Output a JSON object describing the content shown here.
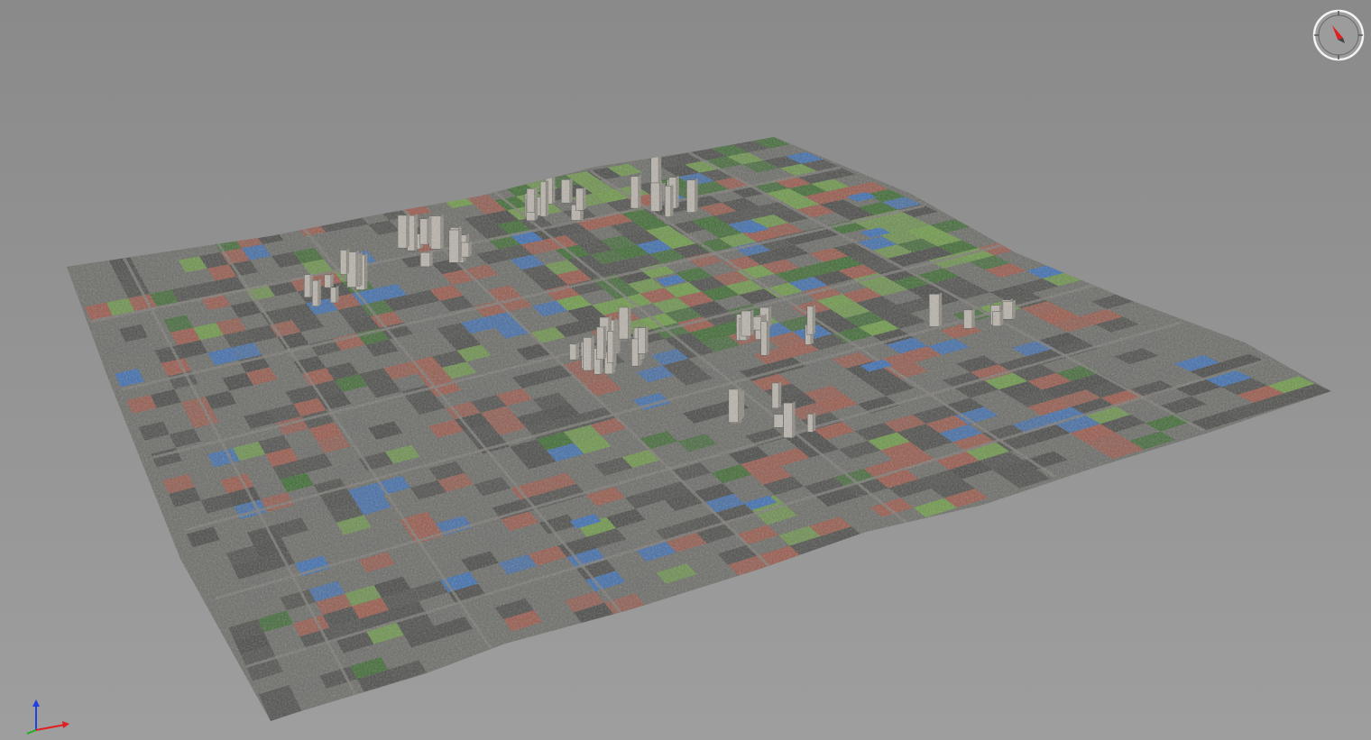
{
  "viewer": {
    "background_top": "#8a8a8a",
    "background_bottom": "#9e9e9e",
    "model": {
      "name": "city-oblique-photogrammetry-tile",
      "tone_urban_gray": "#6c6c68",
      "tone_urban_dark": "#4a4a48",
      "tone_roof_red": "#9a5a4c",
      "tone_roof_blue": "#3f6fb0",
      "tone_vegetation": "#3f6b34",
      "tone_vegetation_light": "#6f9a4a",
      "tone_tower": "#b8b3ab",
      "tone_road": "#7e7c77"
    }
  },
  "compass": {
    "icon": "compass-icon",
    "ring_color": "#f2f2f2",
    "needle_color": "#e02020"
  },
  "axis_gizmo": {
    "icon": "axis-triad-icon",
    "x_color": "#e02020",
    "y_color": "#20b020",
    "z_color": "#2040e0"
  }
}
